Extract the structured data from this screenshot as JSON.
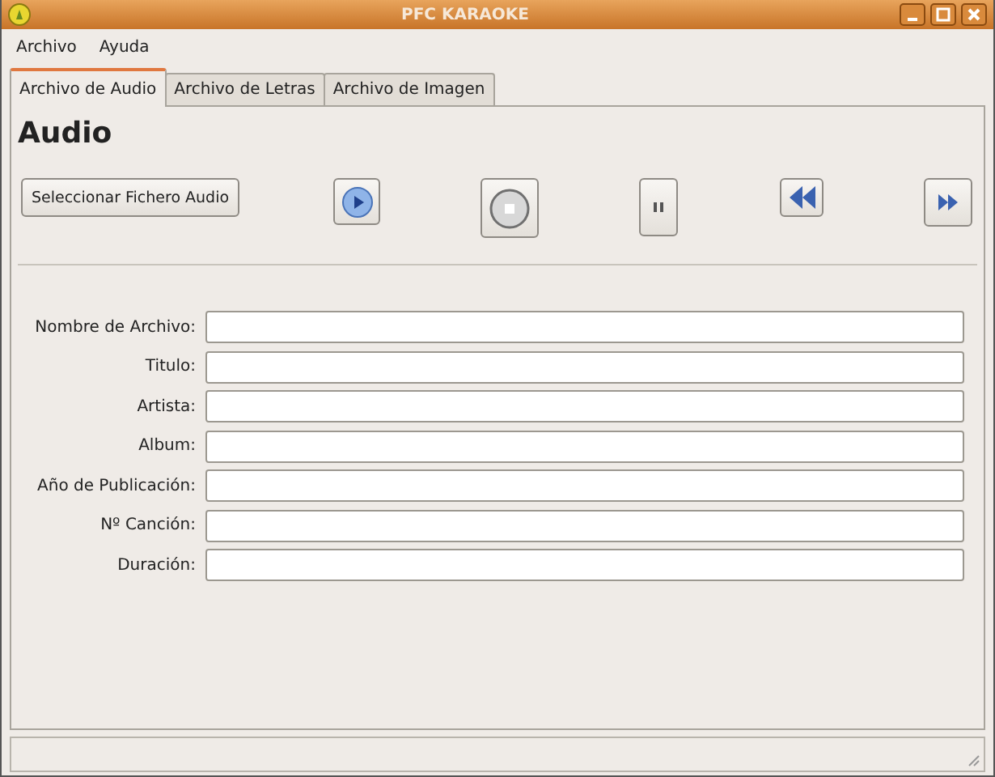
{
  "window": {
    "title": "PFC KARAOKE"
  },
  "menu": [
    "Archivo",
    "Ayuda"
  ],
  "tabs": [
    {
      "label": "Archivo de Audio",
      "selected": true
    },
    {
      "label": "Archivo de Letras",
      "selected": false
    },
    {
      "label": "Archivo de Imagen",
      "selected": false
    }
  ],
  "heading": "Audio",
  "select_button": "Seleccionar Fichero Audio",
  "media_buttons": [
    {
      "kind": "play"
    },
    {
      "kind": "stop"
    },
    {
      "kind": "pause"
    },
    {
      "kind": "rewind"
    },
    {
      "kind": "forward"
    }
  ],
  "fields": [
    {
      "label": "Nombre de Archivo:"
    },
    {
      "label": "Titulo:"
    },
    {
      "label": "Artista:"
    },
    {
      "label": "Album:"
    },
    {
      "label": "Año de Publicación:"
    },
    {
      "label": "Nº Canción:"
    },
    {
      "label": "Duración:"
    }
  ]
}
